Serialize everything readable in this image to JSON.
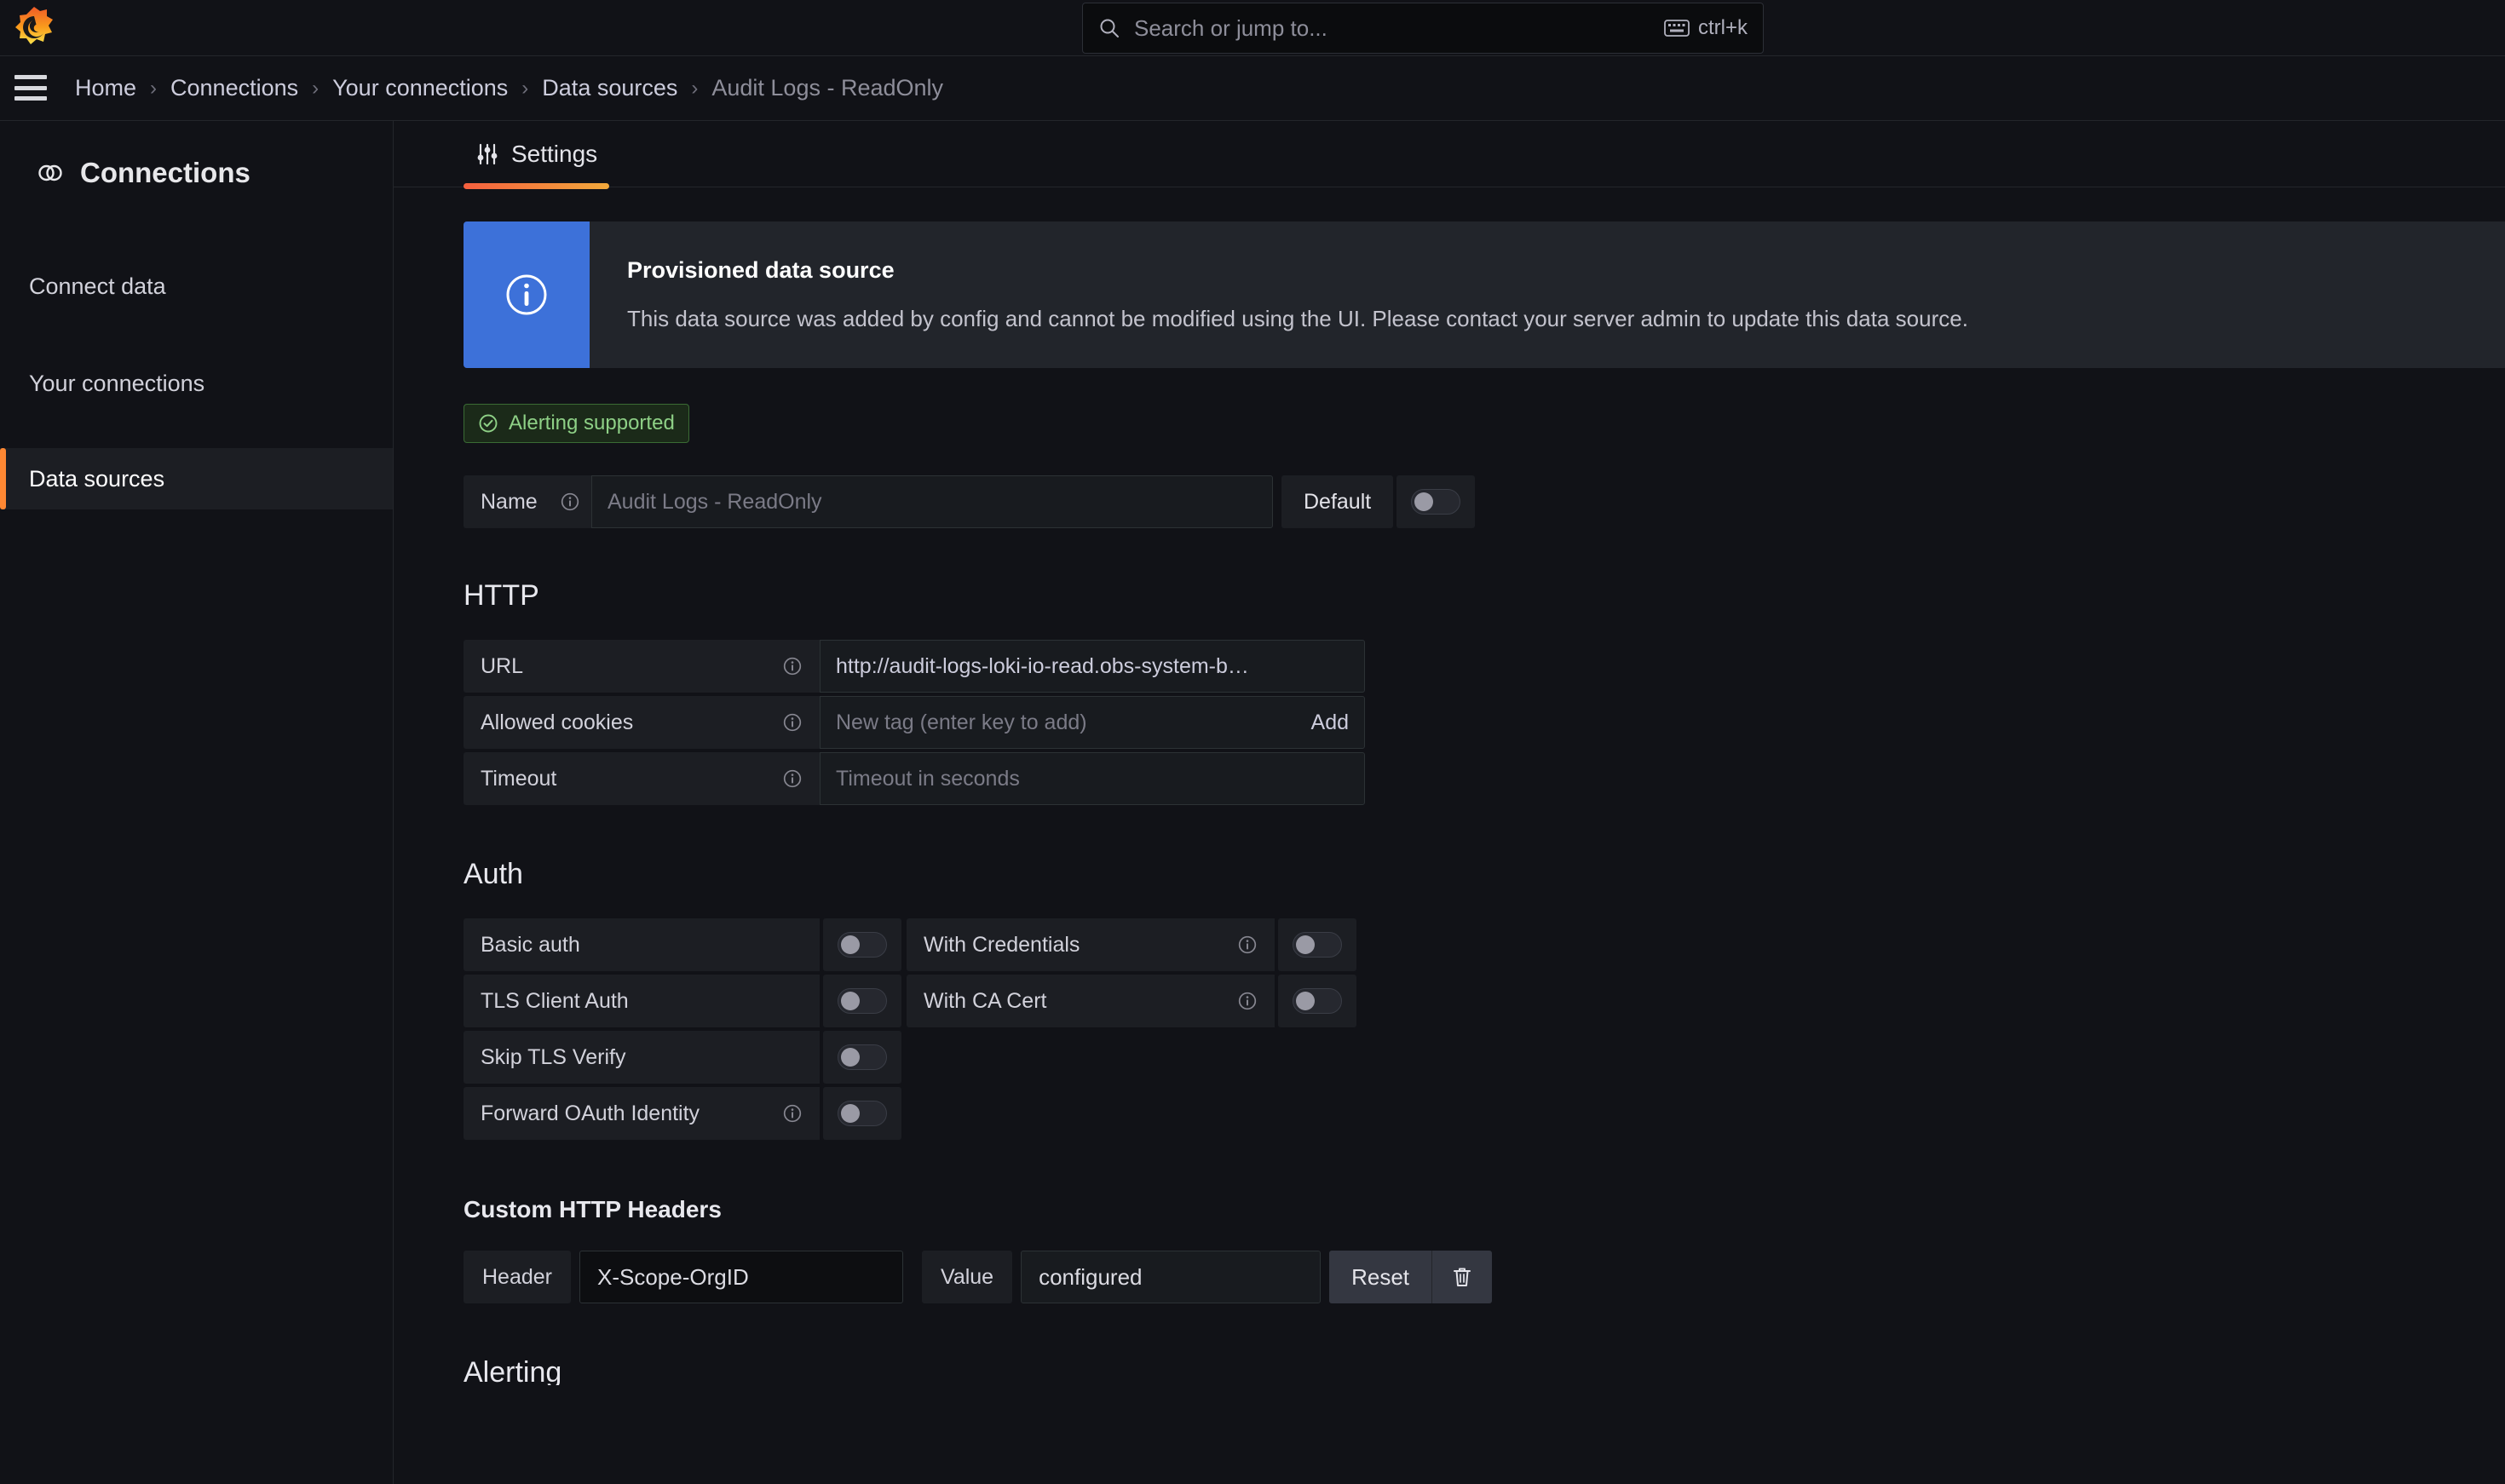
{
  "topbar": {
    "logo_name": "grafana-logo",
    "search": {
      "placeholder": "Search or jump to...",
      "shortcut": "ctrl+k"
    }
  },
  "breadcrumb": {
    "separator": "›",
    "items": [
      {
        "label": "Home"
      },
      {
        "label": "Connections"
      },
      {
        "label": "Your connections"
      },
      {
        "label": "Data sources"
      },
      {
        "label": "Audit Logs - ReadOnly"
      }
    ]
  },
  "sidebar": {
    "title": "Connections",
    "items": [
      {
        "label": "Connect data",
        "active": false
      },
      {
        "label": "Your connections",
        "active": false
      },
      {
        "label": "Data sources",
        "active": true
      }
    ]
  },
  "tabs": [
    {
      "label": "Settings",
      "icon": "sliders-icon",
      "active": true
    }
  ],
  "alert": {
    "icon": "info-circle-icon",
    "title": "Provisioned data source",
    "text": "This data source was added by config and cannot be modified using the UI. Please contact your server admin to update this data source.",
    "strip_color": "#3d71d9"
  },
  "badge": {
    "label": "Alerting supported",
    "icon": "check-circle-icon",
    "color": "#8ed086"
  },
  "name_row": {
    "label": "Name",
    "value": "Audit Logs - ReadOnly",
    "default_label": "Default",
    "default_toggle": "off"
  },
  "http": {
    "heading": "HTTP",
    "fields": [
      {
        "label": "URL",
        "value": "http://audit-logs-loki-io-read.obs-system-b…",
        "placeholder": "",
        "has_info": true,
        "has_add": false
      },
      {
        "label": "Allowed cookies",
        "value": "",
        "placeholder": "New tag (enter key to add)",
        "has_info": true,
        "has_add": true,
        "add_label": "Add"
      },
      {
        "label": "Timeout",
        "value": "",
        "placeholder": "Timeout in seconds",
        "has_info": true,
        "has_add": false
      }
    ]
  },
  "auth": {
    "heading": "Auth",
    "rows": [
      {
        "left": {
          "label": "Basic auth",
          "has_info": false,
          "toggle": "off"
        },
        "right": {
          "label": "With Credentials",
          "has_info": true,
          "toggle": "off"
        }
      },
      {
        "left": {
          "label": "TLS Client Auth",
          "has_info": false,
          "toggle": "off"
        },
        "right": {
          "label": "With CA Cert",
          "has_info": true,
          "toggle": "off"
        }
      },
      {
        "left": {
          "label": "Skip TLS Verify",
          "has_info": false,
          "toggle": "off"
        },
        "right": null
      },
      {
        "left": {
          "label": "Forward OAuth Identity",
          "has_info": true,
          "toggle": "off"
        },
        "right": null
      }
    ]
  },
  "custom_headers": {
    "heading": "Custom HTTP Headers",
    "header_label": "Header",
    "header_value": "X-Scope-OrgID",
    "value_label": "Value",
    "value_value": "configured",
    "reset_label": "Reset",
    "trash_icon": "trash-icon"
  },
  "next_section": {
    "heading": "Alerting"
  }
}
